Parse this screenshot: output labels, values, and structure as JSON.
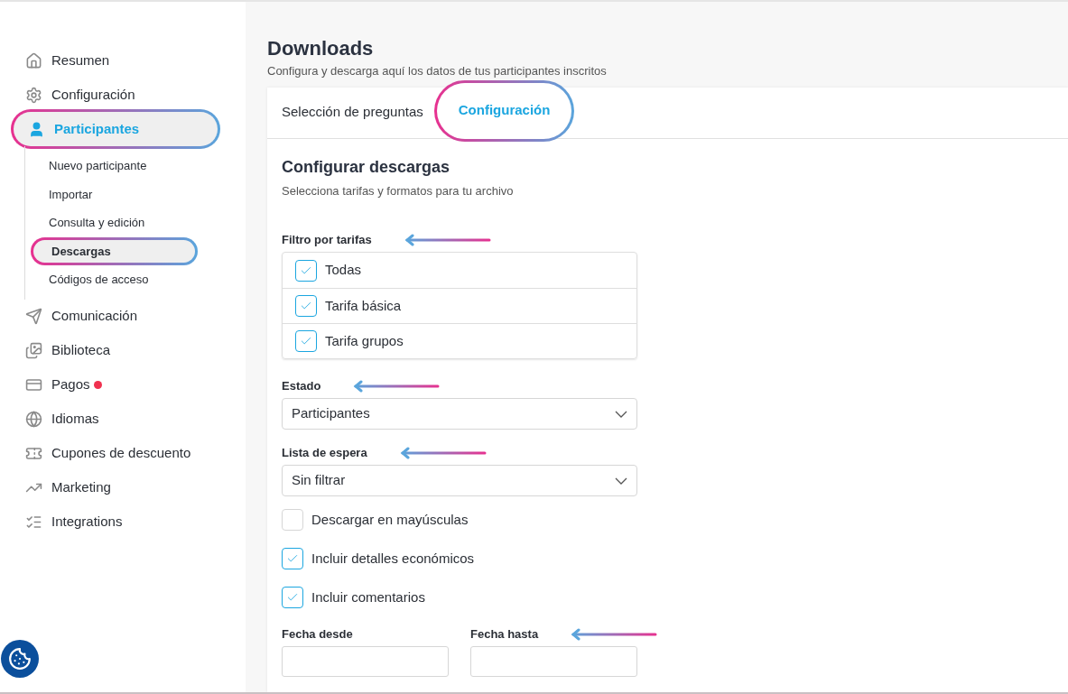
{
  "sidebar": {
    "items": [
      {
        "label": "Resumen",
        "selected": false,
        "highlighted": false,
        "alert": false
      },
      {
        "label": "Configuración",
        "selected": false,
        "highlighted": false,
        "alert": false
      },
      {
        "label": "Participantes",
        "selected": true,
        "highlighted": true,
        "alert": false,
        "children": [
          {
            "label": "Nuevo participante",
            "selected": false,
            "highlighted": false
          },
          {
            "label": "Importar",
            "selected": false,
            "highlighted": false
          },
          {
            "label": "Consulta y edición",
            "selected": false,
            "highlighted": false
          },
          {
            "label": "Descargas",
            "selected": true,
            "highlighted": true
          },
          {
            "label": "Códigos de acceso",
            "selected": false,
            "highlighted": false
          }
        ]
      },
      {
        "label": "Comunicación",
        "selected": false,
        "highlighted": false,
        "alert": false
      },
      {
        "label": "Biblioteca",
        "selected": false,
        "highlighted": false,
        "alert": false
      },
      {
        "label": "Pagos",
        "selected": false,
        "highlighted": false,
        "alert": true
      },
      {
        "label": "Idiomas",
        "selected": false,
        "highlighted": false,
        "alert": false
      },
      {
        "label": "Cupones de descuento",
        "selected": false,
        "highlighted": false,
        "alert": false
      },
      {
        "label": "Marketing",
        "selected": false,
        "highlighted": false,
        "alert": false
      },
      {
        "label": "Integrations",
        "selected": false,
        "highlighted": false,
        "alert": false
      }
    ]
  },
  "page": {
    "title": "Downloads",
    "subtitle": "Configura y descarga aquí los datos de tus participantes inscritos"
  },
  "tabs": [
    {
      "label": "Selección de preguntas",
      "selected": false,
      "highlighted": false
    },
    {
      "label": "Configuración",
      "selected": true,
      "highlighted": true
    }
  ],
  "section": {
    "title": "Configurar descargas",
    "subtitle": "Selecciona tarifas y formatos para tu archivo"
  },
  "tariff_filter": {
    "label": "Filtro por tarifas",
    "arrow": true,
    "options": [
      {
        "label": "Todas",
        "checked": true
      },
      {
        "label": "Tarifa básica",
        "checked": true
      },
      {
        "label": "Tarifa grupos",
        "checked": true
      }
    ]
  },
  "status": {
    "label": "Estado",
    "arrow": true,
    "value": "Participantes"
  },
  "waiting_list": {
    "label": "Lista de espera",
    "arrow": true,
    "value": "Sin filtrar"
  },
  "options": [
    {
      "label": "Descargar en mayúsculas",
      "checked": false
    },
    {
      "label": "Incluir detalles económicos",
      "checked": true
    },
    {
      "label": "Incluir comentarios",
      "checked": true
    }
  ],
  "date_from": {
    "label": "Fecha desde",
    "arrow": false
  },
  "date_to": {
    "label": "Fecha hasta",
    "arrow": true
  }
}
